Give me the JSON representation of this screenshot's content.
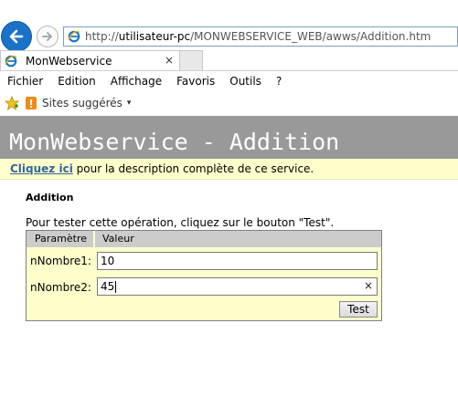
{
  "browser": {
    "url_prefix": "http://",
    "url_host": "utilisateur-pc",
    "url_path": "/MONWEBSERVICE_WEB/awws/Addition.htm",
    "tab_title": "MonWebservice",
    "tab_close": "×",
    "menu": [
      "Fichier",
      "Edition",
      "Affichage",
      "Favoris",
      "Outils",
      "?"
    ],
    "favorites": {
      "sites_label": "Sites suggérés",
      "caret": "▾"
    },
    "icons": {
      "back": "back-arrow-icon",
      "forward": "forward-arrow-icon",
      "site": "ie-logo-icon"
    }
  },
  "page": {
    "title": "MonWebservice - Addition",
    "description": {
      "link": "Cliquez ici",
      "text": " pour la description complète de ce service."
    },
    "section_title": "Addition",
    "instructions": "Pour tester cette opération, cliquez sur le bouton \"Test\".",
    "table": {
      "headers": [
        "Paramètre",
        "Valeur"
      ],
      "rows": [
        {
          "label": "nNombre1:",
          "value": "10"
        },
        {
          "label": "nNombre2:",
          "value": "45",
          "clear": "×"
        }
      ]
    },
    "test_button": "Test"
  },
  "colors": {
    "header_bg": "#999999",
    "desc_bg": "#ffffcc",
    "link": "#336699",
    "ie_blue": "#1a73c8"
  }
}
